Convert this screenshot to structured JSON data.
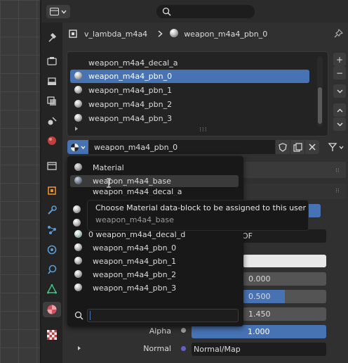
{
  "breadcrumb": {
    "object_name": "v_lambda_m4a4",
    "material_name": "weapon_m4a4_pbn_0"
  },
  "slot_list": {
    "items": [
      {
        "label": "weapon_m4a4_decal_a",
        "selected": false,
        "icon": "none"
      },
      {
        "label": "weapon_m4a4_pbn_0",
        "selected": true,
        "icon": "material-sphere-icon"
      },
      {
        "label": "weapon_m4a4_pbn_1",
        "selected": false,
        "icon": "material-sphere-icon"
      },
      {
        "label": "weapon_m4a4_pbn_2",
        "selected": false,
        "icon": "material-sphere-icon"
      },
      {
        "label": "weapon_m4a4_pbn_3",
        "selected": false,
        "icon": "material-sphere-icon"
      }
    ],
    "add_label": "+",
    "remove_label": "−"
  },
  "material_selector": {
    "value": "weapon_m4a4_pbn_0"
  },
  "dropdown_menu": {
    "items": [
      {
        "label": "Material"
      },
      {
        "label": "weapon_m4a4_base",
        "highlighted": true
      },
      {
        "label": "weapon_m4a4_decal_a"
      },
      {
        "label": ""
      },
      {
        "label": ""
      },
      {
        "label": "0 weapon_m4a4_decal_d"
      },
      {
        "label": "weapon_m4a4_pbn_0"
      },
      {
        "label": "weapon_m4a4_pbn_1"
      },
      {
        "label": "weapon_m4a4_pbn_2"
      },
      {
        "label": "weapon_m4a4_pbn_3"
      }
    ],
    "search_value": ""
  },
  "tooltip": {
    "title": "Choose Material data-block to be assigned to this user",
    "subtitle": "weapon_m4a4_base"
  },
  "properties": {
    "partial_field_text": "OF",
    "value_1": "0.000",
    "value_2": "0.500",
    "value_3": "1.450",
    "alpha_label": "Alpha",
    "alpha_value": "1.000",
    "alpha_fraction": 1.0,
    "value_2_fraction": 0.5,
    "normal_label": "Normal",
    "normal_value": "Normal/Map"
  },
  "colors": {
    "selection": "#4772b3",
    "property_fill": "#4772b3",
    "panel_bg": "#303030",
    "menu_bg": "#181818"
  }
}
